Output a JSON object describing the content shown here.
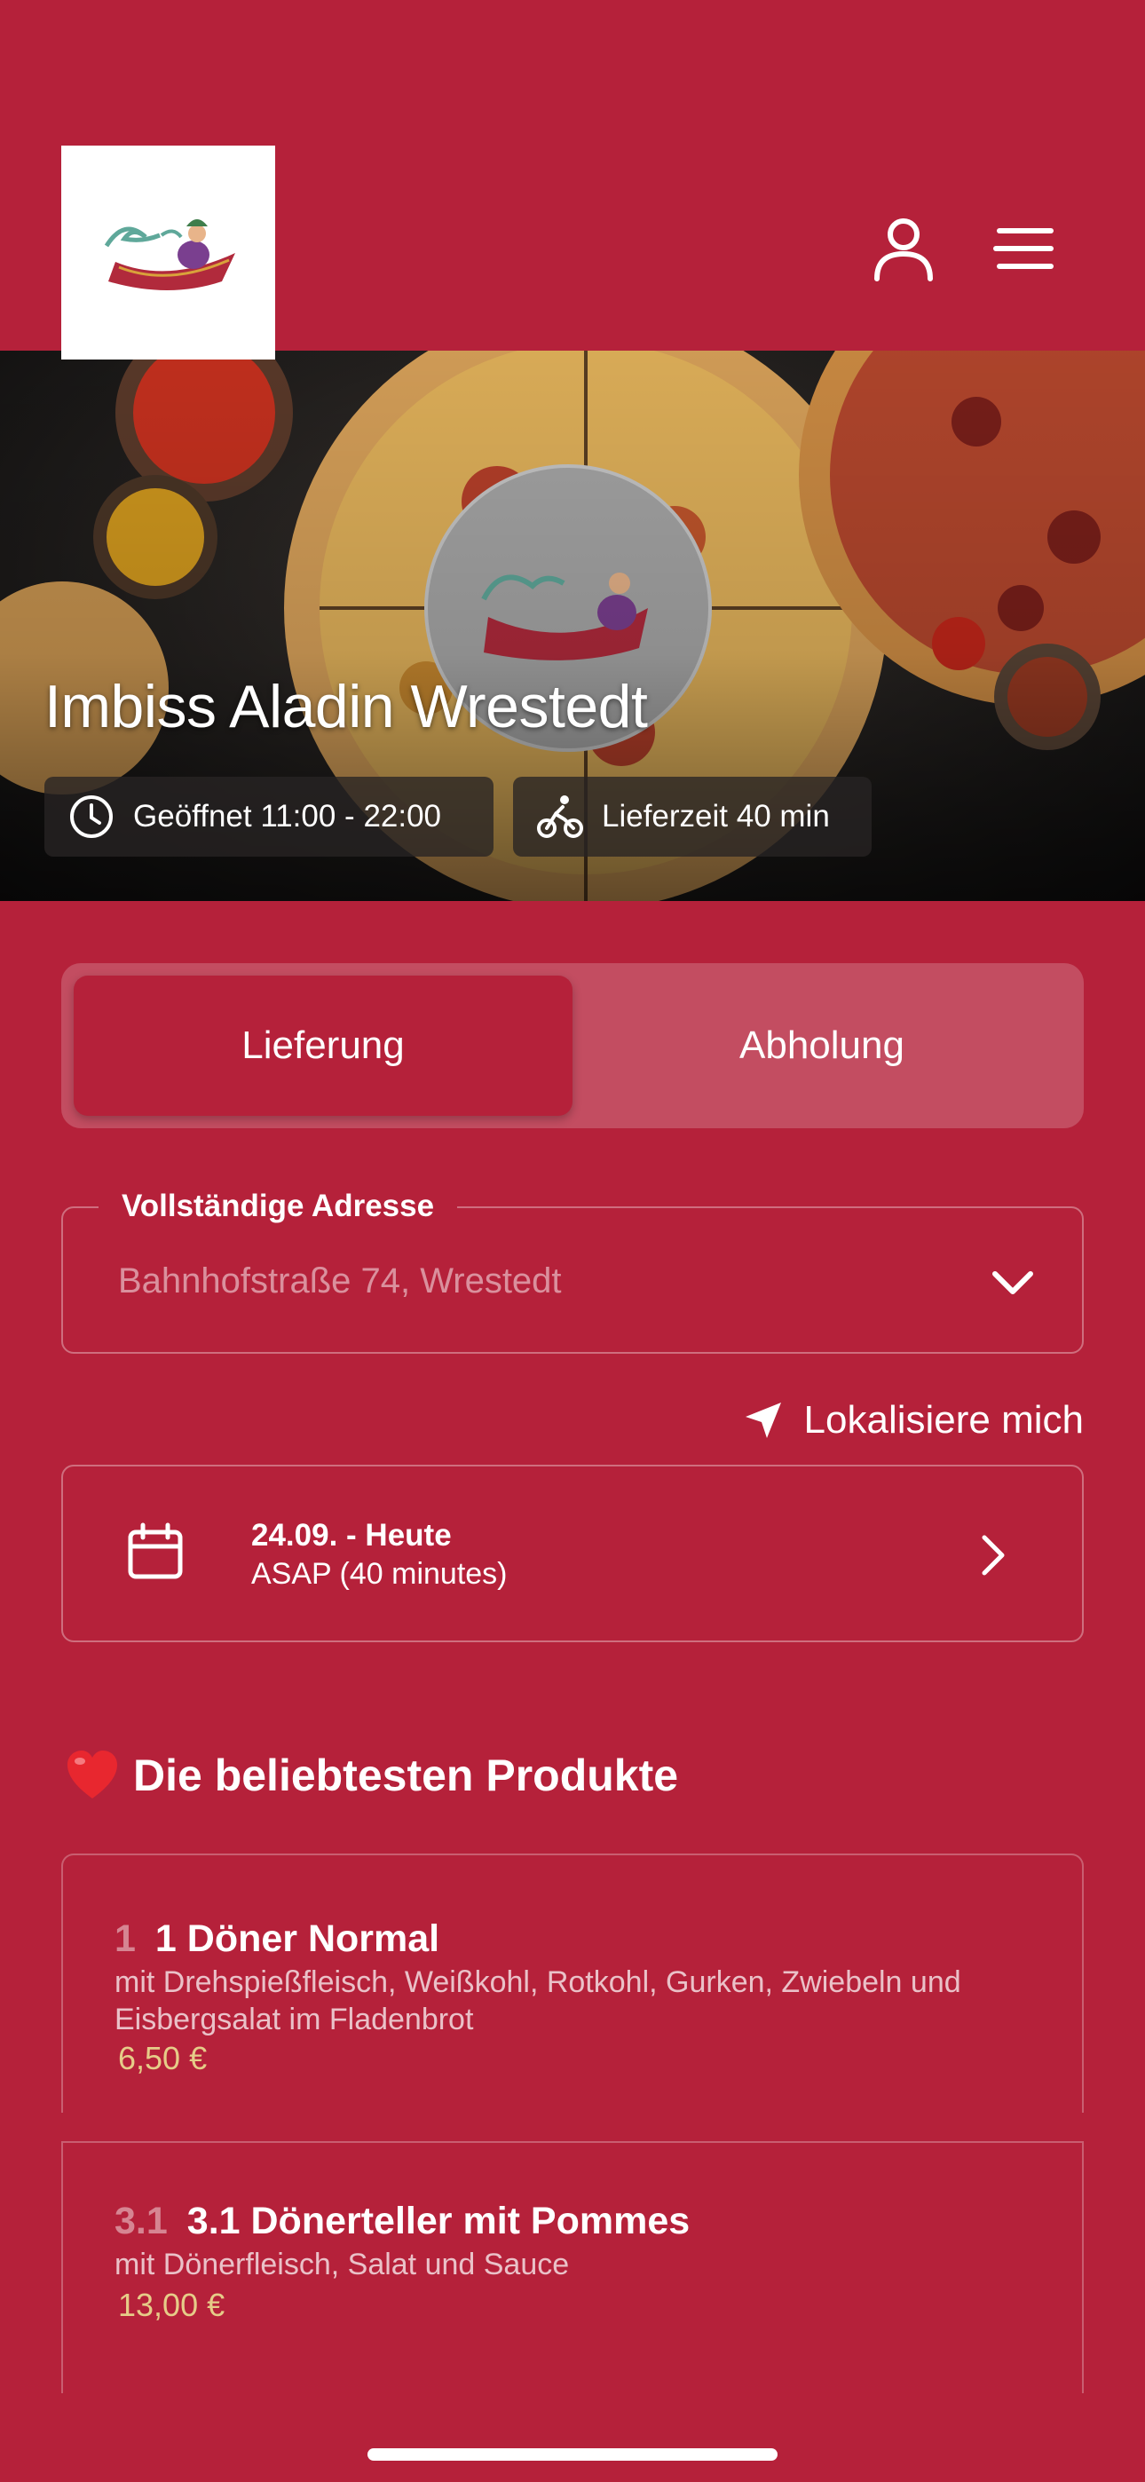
{
  "header": {
    "logo_icon": "aladin-logo-icon",
    "user_icon": "user-icon",
    "menu_icon": "menu-icon"
  },
  "hero": {
    "title": "Imbiss Aladin Wrestedt",
    "opening_hours": "Geöffnet 11:00 - 22:00",
    "delivery_time": "Lieferzeit 40 min",
    "clock_icon": "clock-icon",
    "bike_icon": "bicycle-icon"
  },
  "order_mode": {
    "active_label": "Lieferung",
    "inactive_label": "Abholung"
  },
  "address": {
    "label": "Vollständige Adresse",
    "value": "Bahnhofstraße 74, Wrestedt"
  },
  "locate": {
    "label": "Lokalisiere mich"
  },
  "schedule": {
    "date": "24.09. - Heute",
    "time": "ASAP (40 minutes)"
  },
  "popular": {
    "title": "Die beliebtesten Produkte",
    "products": [
      {
        "number": "1",
        "name": "1 Döner Normal",
        "description": "mit Drehspießfleisch, Weißkohl, Rotkohl, Gurken, Zwiebeln und Eisbergsalat im Fladenbrot",
        "price": "6,50 €"
      },
      {
        "number": "3.1",
        "name": "3.1 Dönerteller mit Pommes",
        "description": "mit Dönerfleisch, Salat und Sauce",
        "price": "13,00 €"
      }
    ]
  },
  "colors": {
    "background": "#b5213a",
    "price": "#e6cc88"
  }
}
